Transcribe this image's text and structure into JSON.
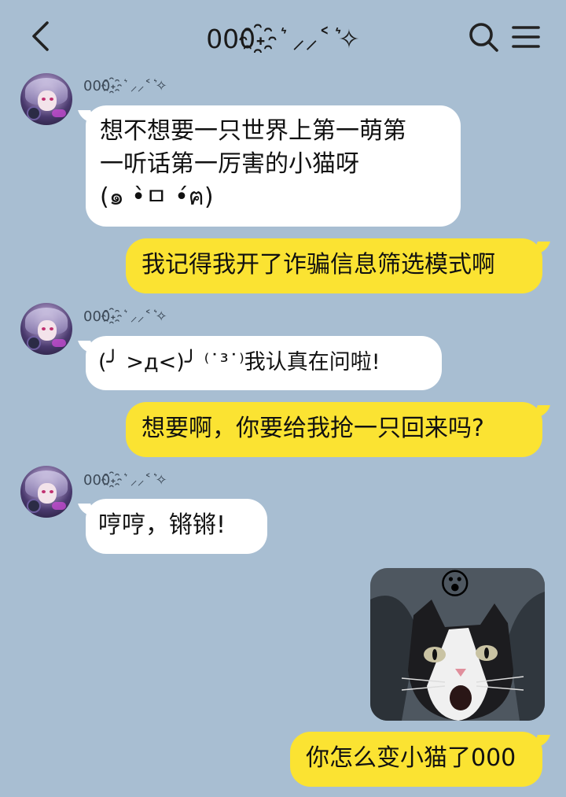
{
  "header": {
    "title": "000˖҈ ͛ ⸝⸝˂ ͛✧",
    "back_icon": "chevron-left-icon",
    "search_icon": "search-icon",
    "menu_icon": "hamburger-menu-icon"
  },
  "messages": [
    {
      "side": "left",
      "sender": "000˖҈ ͛ ⸝⸝˂ ͛✧",
      "text": "想不想要一只世界上第一萌第\n一听话第一厉害的小猫呀\n(๑ •̀ㅁ •́ฅ)"
    },
    {
      "side": "right",
      "text": "我记得我开了诈骗信息筛选模式啊"
    },
    {
      "side": "left",
      "sender": "000˖҈ ͛ ⸝⸝˂ ͛✧",
      "text": "(╯ >д<)╯ ⁽˙³˙⁾我认真在问啦!"
    },
    {
      "side": "right",
      "text": "想要啊，你要给我抢一只回来吗?"
    },
    {
      "side": "left",
      "sender": "000˖҈ ͛ ⸝⸝˂ ͛✧",
      "text": "哼哼，锵锵!"
    },
    {
      "side": "right",
      "type": "image",
      "image_desc": "cat-sticker",
      "emoji": "😮"
    },
    {
      "side": "right",
      "text": "你怎么变小猫了000"
    }
  ],
  "colors": {
    "background": "#a8bed2",
    "my_bubble": "#fbe332",
    "their_bubble": "#ffffff"
  }
}
